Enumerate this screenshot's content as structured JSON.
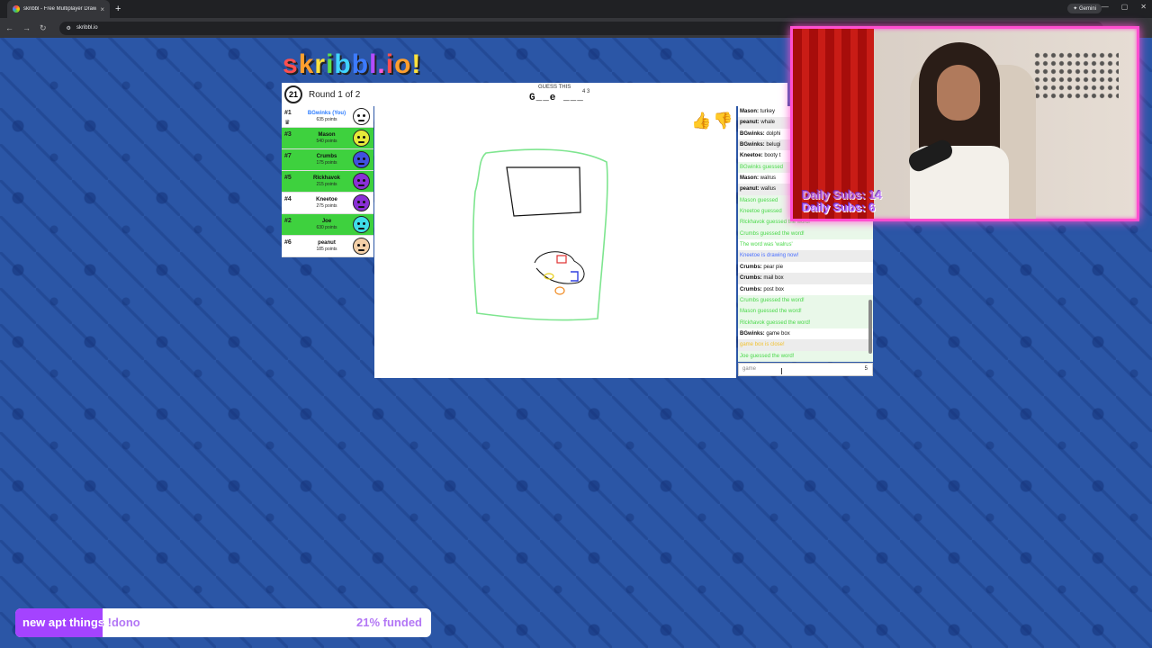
{
  "browser": {
    "tab_title": "skribbl - Free Multiplayer Drawi",
    "new_tab": "+",
    "url": "skribbl.io",
    "gemini": "✦ Gemini"
  },
  "logo": "skribbl.io!",
  "game": {
    "timer": "21",
    "round": "Round 1 of 2",
    "guess_label": "GUESS THIS",
    "hint": "G__e ___",
    "hint_numbers": "4 3"
  },
  "players": [
    {
      "rank": "#1",
      "name": "BGwinks (You)",
      "points": "635 points",
      "highlight": false,
      "you": true,
      "color": "#ffffff"
    },
    {
      "rank": "#3",
      "name": "Mason",
      "points": "540 points",
      "highlight": true,
      "you": false,
      "color": "#e6e93a"
    },
    {
      "rank": "#7",
      "name": "Crumbs",
      "points": "175 points",
      "highlight": true,
      "you": false,
      "color": "#4051e0"
    },
    {
      "rank": "#5",
      "name": "Rlckhavok",
      "points": "215 points",
      "highlight": true,
      "you": false,
      "color": "#8a2fd6"
    },
    {
      "rank": "#4",
      "name": "Kneetoe",
      "points": "275 points",
      "highlight": false,
      "you": false,
      "color": "#8a2fd6"
    },
    {
      "rank": "#2",
      "name": "Joe",
      "points": "630 points",
      "highlight": true,
      "you": false,
      "color": "#3fdde8"
    },
    {
      "rank": "#6",
      "name": "peanut",
      "points": "185 points",
      "highlight": false,
      "you": false,
      "color": "#f4d0a8"
    }
  ],
  "chat": [
    {
      "user": "Mason:",
      "text": "turkey",
      "type": "normal"
    },
    {
      "user": "peanut:",
      "text": "whale",
      "type": "normal"
    },
    {
      "user": "BGwinks:",
      "text": "dolphi",
      "type": "normal"
    },
    {
      "user": "BGwinks:",
      "text": "belugi",
      "type": "normal"
    },
    {
      "user": "Kneetoe:",
      "text": "booty t",
      "type": "normal"
    },
    {
      "user": "",
      "text": "BGwinks guessed",
      "type": "ok"
    },
    {
      "user": "Mason:",
      "text": "walrus",
      "type": "normal"
    },
    {
      "user": "peanut:",
      "text": "wallus",
      "type": "normal"
    },
    {
      "user": "",
      "text": "Mason guessed",
      "type": "ok"
    },
    {
      "user": "",
      "text": "Kneetoe guessed",
      "type": "ok"
    },
    {
      "user": "",
      "text": "Rlckhavok guessed the word!",
      "type": "ok"
    },
    {
      "user": "",
      "text": "Crumbs guessed the word!",
      "type": "ok"
    },
    {
      "user": "",
      "text": "The word was 'walrus'",
      "type": "ok2"
    },
    {
      "user": "",
      "text": "Kneetoe is drawing now!",
      "type": "blue"
    },
    {
      "user": "Crumbs:",
      "text": "pear pie",
      "type": "normal"
    },
    {
      "user": "Crumbs:",
      "text": "mail box",
      "type": "normal"
    },
    {
      "user": "Crumbs:",
      "text": "post box",
      "type": "normal"
    },
    {
      "user": "",
      "text": "Crumbs guessed the word!",
      "type": "ok"
    },
    {
      "user": "",
      "text": "Mason guessed the word!",
      "type": "ok"
    },
    {
      "user": "",
      "text": "Rlckhavok guessed the word!",
      "type": "ok"
    },
    {
      "user": "BGwinks:",
      "text": "game box",
      "type": "normal"
    },
    {
      "user": "",
      "text": "game box is close!",
      "type": "gold"
    },
    {
      "user": "",
      "text": "Joe guessed the word!",
      "type": "ok"
    }
  ],
  "chat_input": {
    "value": "game",
    "count": "5"
  },
  "stream": {
    "daily_subs_1": "Daily Subs: 14",
    "daily_subs_2": "Daily Subs: 6"
  },
  "donation": {
    "text": "new apt things !dono",
    "percent_label": "21% funded",
    "fraction": 0.21
  },
  "colors": {
    "accent": "#ff4fd0",
    "chat_green": "#4ad84a",
    "player_green": "#3ed13e",
    "dono_purple": "#a443ff"
  }
}
